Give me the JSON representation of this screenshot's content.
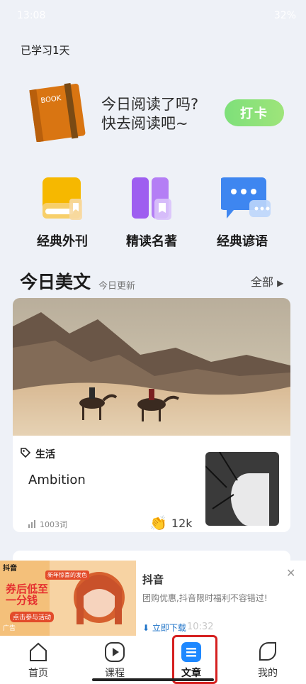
{
  "status": {
    "time": "13:08",
    "battery": "32%"
  },
  "streak": "已学习1天",
  "reading": {
    "title": "今日阅读了吗?",
    "subtitle": "快去阅读吧~",
    "checkin": "打卡",
    "book_label": "BOOK"
  },
  "categories": [
    {
      "label": "经典外刊",
      "icon": "magazine-icon"
    },
    {
      "label": "精读名著",
      "icon": "books-icon"
    },
    {
      "label": "经典谚语",
      "icon": "chat-bubble-icon"
    }
  ],
  "section": {
    "title": "今日美文",
    "subtitle": "今日更新",
    "all": "全部"
  },
  "article": {
    "tag": "生活",
    "title": "Ambition",
    "words": "1003词",
    "claps": "12k"
  },
  "ad": {
    "brand": "抖音",
    "title": "抖音",
    "desc": "团购优惠,抖音限时福利不容错过!",
    "download": "立即下载",
    "badge": "广告",
    "time": "10:32",
    "promo_top": "新年惊喜的发色",
    "promo_big": "券后低至一分钱",
    "promo_btn": "点击参与活动"
  },
  "nav": [
    {
      "label": "首页",
      "icon": "home-icon"
    },
    {
      "label": "课程",
      "icon": "play-icon"
    },
    {
      "label": "文章",
      "icon": "article-icon"
    },
    {
      "label": "我的",
      "icon": "leaf-icon"
    }
  ],
  "colors": {
    "accent": "#1e88ff",
    "checkin": "#8fe27a",
    "highlight": "#d52020"
  }
}
